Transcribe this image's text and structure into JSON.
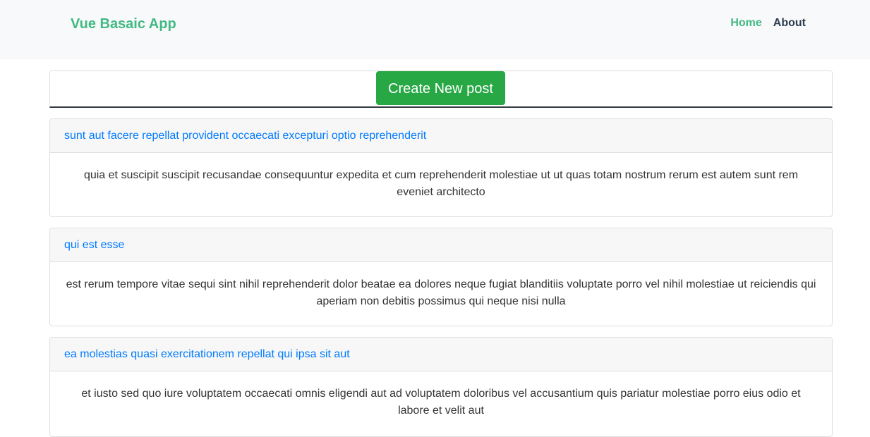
{
  "navbar": {
    "brand": "Vue Basaic App",
    "links": [
      {
        "label": "Home"
      },
      {
        "label": "About"
      }
    ]
  },
  "create_button_label": "Create New post",
  "posts": [
    {
      "title": "sunt aut facere repellat provident occaecati excepturi optio reprehenderit",
      "body": "quia et suscipit suscipit recusandae consequuntur expedita et cum reprehenderit molestiae ut ut quas totam nostrum rerum est autem sunt rem eveniet architecto"
    },
    {
      "title": "qui est esse",
      "body": "est rerum tempore vitae sequi sint nihil reprehenderit dolor beatae ea dolores neque fugiat blanditiis voluptate porro vel nihil molestiae ut reiciendis qui aperiam non debitis possimus qui neque nisi nulla"
    },
    {
      "title": "ea molestias quasi exercitationem repellat qui ipsa sit aut",
      "body": "et iusto sed quo iure voluptatem occaecati omnis eligendi aut ad voluptatem doloribus vel accusantium quis pariatur molestiae porro eius odio et labore et velit aut"
    }
  ],
  "colors": {
    "brand_green": "#42b983",
    "button_green": "#28a745",
    "link_blue": "#007bff",
    "text_dark": "#2c3e50"
  }
}
